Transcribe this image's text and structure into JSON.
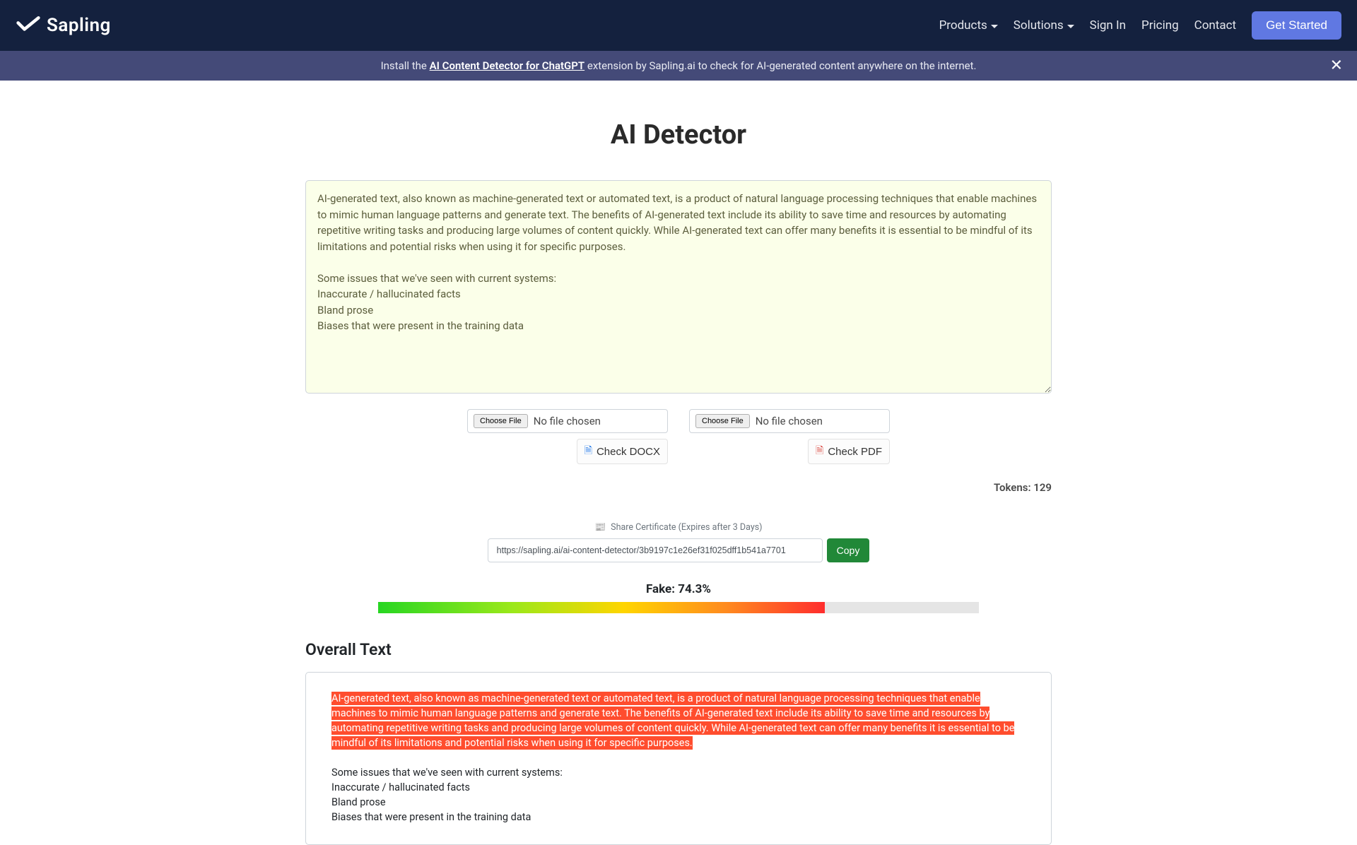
{
  "brand": {
    "name": "Sapling"
  },
  "nav": {
    "products": "Products",
    "solutions": "Solutions",
    "sign_in": "Sign In",
    "pricing": "Pricing",
    "contact": "Contact",
    "get_started": "Get Started"
  },
  "banner": {
    "prefix": "Install the ",
    "link_text": "AI Content Detector for ChatGPT",
    "suffix": " extension by Sapling.ai to check for AI-generated content anywhere on the internet."
  },
  "page": {
    "title": "AI Detector"
  },
  "textarea": {
    "value": "AI-generated text, also known as machine-generated text or automated text, is a product of natural language processing techniques that enable machines to mimic human language patterns and generate text. The benefits of AI-generated text include its ability to save time and resources by automating repetitive writing tasks and producing large volumes of content quickly. While AI-generated text can offer many benefits it is essential to be mindful of its limitations and potential risks when using it for specific purposes.\n\nSome issues that we've seen with current systems:\nInaccurate / hallucinated facts\nBland prose\nBiases that were present in the training data"
  },
  "file": {
    "choose_label": "Choose File",
    "no_file": "No file chosen",
    "check_docx": "Check DOCX",
    "check_pdf": "Check PDF"
  },
  "tokens": {
    "label": "Tokens: ",
    "value": "129"
  },
  "share": {
    "label": "Share Certificate (Expires after 3 Days)",
    "url": "https://sapling.ai/ai-content-detector/3b9197c1e26ef31f025dff1b541a7701",
    "copy": "Copy"
  },
  "score": {
    "label": "Fake: 74.3%",
    "percent": 74.3
  },
  "overall": {
    "heading": "Overall Text",
    "highlighted": "AI-generated text, also known as machine-generated text or automated text, is a product of natural language processing techniques that enable machines to mimic human language patterns and generate text. The benefits of AI-generated text include its ability to save time and resources by automating repetitive writing tasks and producing large volumes of content quickly. While AI-generated text can offer many benefits it is essential to be mindful of its limitations and potential risks when using it for specific purposes.",
    "rest": "\n\nSome issues that we've seen with current systems:\nInaccurate / hallucinated facts\nBland prose\nBiases that were present in the training data"
  },
  "colors": {
    "navbar_bg": "#14213e",
    "banner_bg": "#444a78",
    "accent_blue": "#6078e2",
    "accent_green": "#218838",
    "textarea_bg": "#fbffe9",
    "highlight": "#ff4d2e"
  }
}
